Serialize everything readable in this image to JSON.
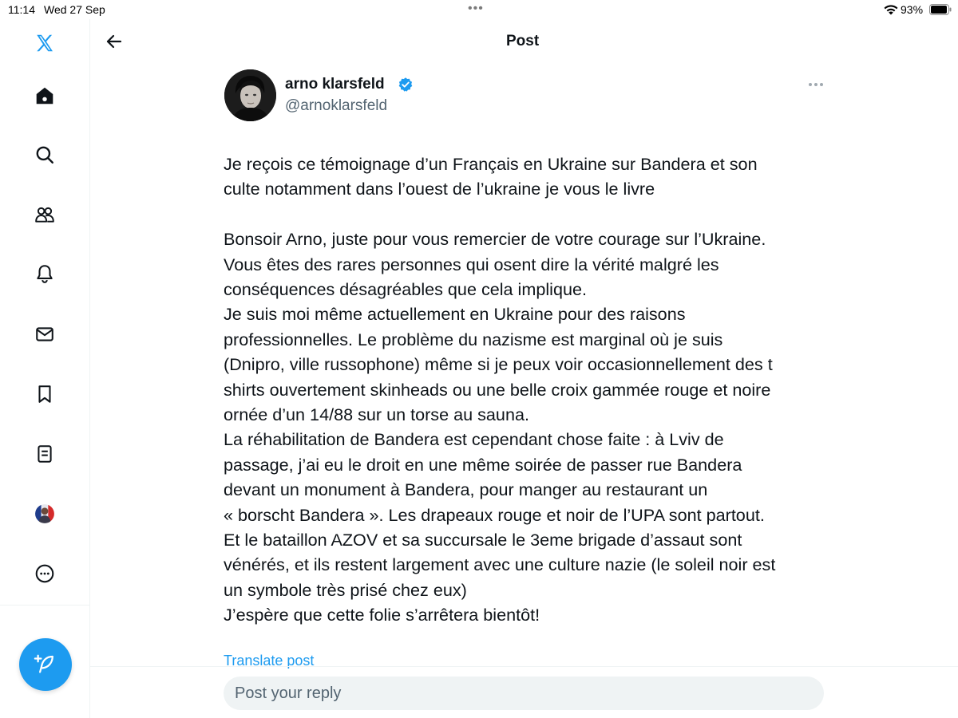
{
  "status_bar": {
    "time": "11:14",
    "date": "Wed 27 Sep",
    "battery": "93%"
  },
  "sidebar": {
    "items": [
      {
        "name": "x-logo",
        "icon": "x-logo-icon"
      },
      {
        "name": "home",
        "icon": "home-icon"
      },
      {
        "name": "explore",
        "icon": "search-icon"
      },
      {
        "name": "communities",
        "icon": "people-icon"
      },
      {
        "name": "notifications",
        "icon": "bell-icon"
      },
      {
        "name": "messages",
        "icon": "mail-icon"
      },
      {
        "name": "bookmarks",
        "icon": "bookmark-icon"
      },
      {
        "name": "lists",
        "icon": "list-icon"
      },
      {
        "name": "profile",
        "icon": "avatar-icon"
      },
      {
        "name": "more",
        "icon": "more-circle-icon"
      }
    ],
    "compose_icon": "compose-feather-icon"
  },
  "header": {
    "title": "Post",
    "back_icon": "arrow-left-icon"
  },
  "tweet": {
    "author_name": "arno klarsfeld",
    "author_handle": "@arnoklarsfeld",
    "verified": true,
    "lines": [
      "Je reçois ce témoignage d’un Français en Ukraine sur Bandera et son",
      "culte notamment dans l’ouest de l’ukraine je vous le livre",
      "",
      "Bonsoir Arno, juste pour vous remercier de votre courage sur l’Ukraine.",
      "Vous êtes des rares personnes qui osent dire la vérité malgré les",
      "conséquences désagréables que cela implique.",
      "Je suis moi même actuellement en Ukraine pour des raisons",
      "professionnelles. Le problème du nazisme est marginal où je suis",
      "(Dnipro, ville russophone) même si je peux voir occasionnellement des t",
      "shirts ouvertement skinheads ou une belle croix gammée rouge et noire",
      "ornée d’un 14/88 sur un torse au sauna.",
      "La réhabilitation de Bandera est cependant chose faite : à Lviv de",
      "passage, j’ai eu le droit en une même soirée de passer rue Bandera",
      "devant un monument à Bandera, pour manger au restaurant un",
      "« borscht Bandera ». Les drapeaux rouge et noir de l’UPA sont partout.",
      "Et le bataillon AZOV et sa succursale le 3eme brigade d’assaut sont",
      "vénérés, et ils restent largement avec une culture nazie (le soleil noir est",
      "un symbole très prisé chez eux)",
      "J’espère que cette folie s’arrêtera bientôt!"
    ],
    "translate_label": "Translate post"
  },
  "reply": {
    "placeholder": "Post your reply"
  },
  "colors": {
    "accent": "#1d9bf0",
    "text": "#0f1419",
    "secondary": "#536471",
    "border": "#eff3f4"
  }
}
